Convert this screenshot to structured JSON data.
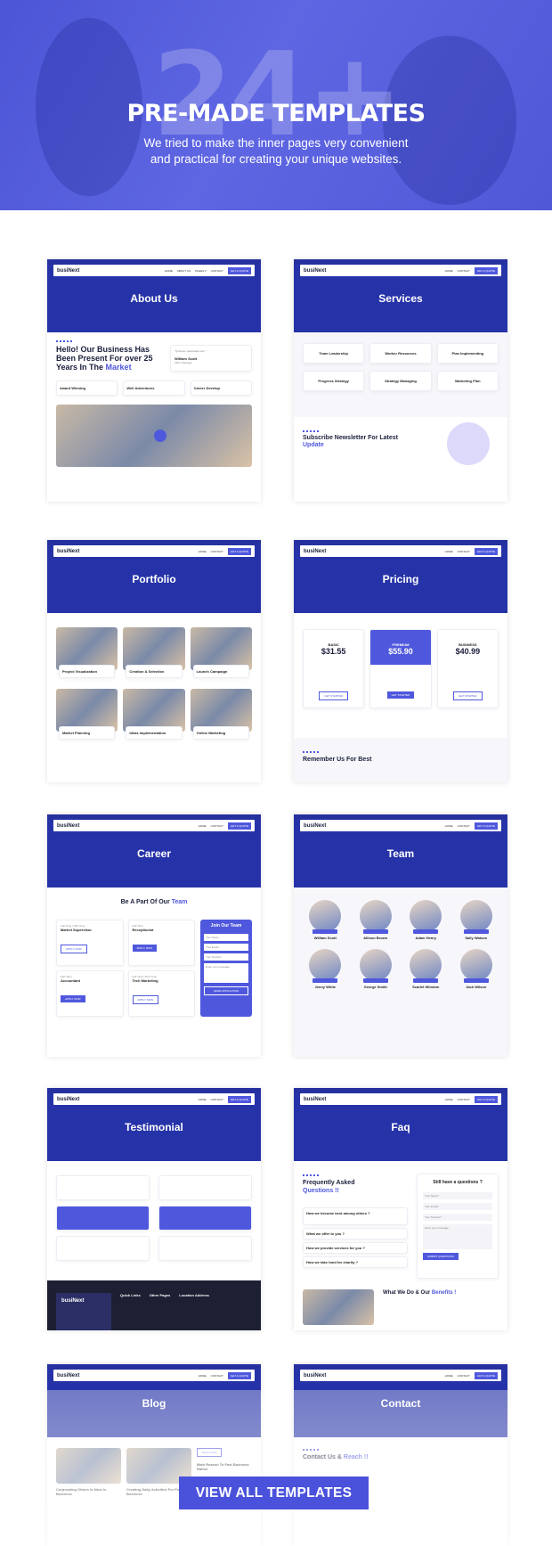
{
  "hero": {
    "big_number": "24+",
    "title": "PRE-MADE TEMPLATES",
    "subtitle_line1": "We tried to make the inner pages very convenient",
    "subtitle_line2": "and practical for creating your unique websites."
  },
  "nav": {
    "logo_a": "busi",
    "logo_b": "Next",
    "items": [
      "HOME",
      "ABOUT US",
      "PAGES ▾",
      "BLOG ▾",
      "SHOP ▾",
      "CONTACT"
    ],
    "cta": "GET A QUOTE"
  },
  "about": {
    "title": "About Us",
    "heading": "Hello! Our Business Has Been Present For over 25 Years In The",
    "accent": "Market",
    "author": "William Scott",
    "role": "CEO, Manager",
    "features": [
      "Award Winning",
      "Well Adventures",
      "Career Develop"
    ]
  },
  "services": {
    "title": "Services",
    "items": [
      "Team Leadership",
      "Worker Resources",
      "Plan Implementing",
      "Progress Strategy",
      "Strategy Managing",
      "Marketing Plan"
    ],
    "newsletter": "Subscribe Newsletter For Latest",
    "accent": "Update"
  },
  "portfolio": {
    "title": "Portfolio",
    "items": [
      "Project Visualization",
      "Creation & Selection",
      "Launch Campaign",
      "Market Planning",
      "Ideas Implementation",
      "Online Marketing"
    ]
  },
  "pricing": {
    "title": "Pricing",
    "plans": [
      {
        "name": "BASIC",
        "price": "$31.55",
        "button": "GET STARTED"
      },
      {
        "name": "PREMIUM",
        "price": "$55.90",
        "button": "GET STARTED"
      },
      {
        "name": "BUSINESS",
        "price": "$40.99",
        "button": "GET STARTED"
      }
    ],
    "bottom": "Remember Us For Best"
  },
  "career": {
    "title": "Career",
    "heading": "Be A Part Of Our",
    "accent": "Team",
    "jobs": [
      {
        "type": "Full Time / Part Time",
        "title": "Market Supervisor",
        "button": "APPLY NOW"
      },
      {
        "type": "Full Time",
        "title": "Receptionist",
        "button": "APPLY NOW"
      },
      {
        "type": "Part Time",
        "title": "Accountant",
        "button": "APPLY NOW"
      },
      {
        "type": "Full Time / Part Time",
        "title": "Tech Marketing",
        "button": "APPLY NOW"
      }
    ],
    "form_title": "Join Our Team",
    "fields": [
      "Your Name",
      "Your Email",
      "Your Number",
      "Enter your message"
    ],
    "submit": "SEND APPLICATION"
  },
  "team": {
    "title": "Team",
    "members": [
      {
        "name": "William Scott"
      },
      {
        "name": "Allison Brown"
      },
      {
        "name": "Adam Henry"
      },
      {
        "name": "Sally Watson"
      },
      {
        "name": "Jenny White"
      },
      {
        "name": "George Smith"
      },
      {
        "name": "Scarlet Winston"
      },
      {
        "name": "Jack Wilson"
      }
    ]
  },
  "testimonial": {
    "title": "Testimonial",
    "footer_cols": [
      "Quick Links",
      "Other Pages",
      "Location Address"
    ]
  },
  "faq": {
    "title": "Faq",
    "heading": "Frequently Asked",
    "accent": "Questions !!",
    "questions": [
      "How we become best among others ?",
      "What we offer to you ?",
      "How we provide services for you ?",
      "How we take fund for charity ?"
    ],
    "form_title": "Still have a questions ?",
    "fields": [
      "Your Name*",
      "Your Email*",
      "Your Number*",
      "Enter your message"
    ],
    "submit": "SUBMIT QUESTIONS",
    "bottom": "What We Do & Our",
    "bottom_accent": "Benefits !"
  },
  "blog": {
    "title": "Blog",
    "posts": [
      "Corporating Others Is Must In Business",
      "Creating Daily Activities For Positive Business"
    ],
    "sidebar": "Recent Post",
    "recent": "Main Reason To Fast Business Rather"
  },
  "contact": {
    "title": "Contact",
    "heading": "Contact Us &",
    "accent": "Reach !!"
  },
  "view_all": "VIEW ALL TEMPLATES",
  "colors": {
    "accent": "#4f58dd",
    "banner": "#2633a8",
    "hero": "#5058d8"
  }
}
